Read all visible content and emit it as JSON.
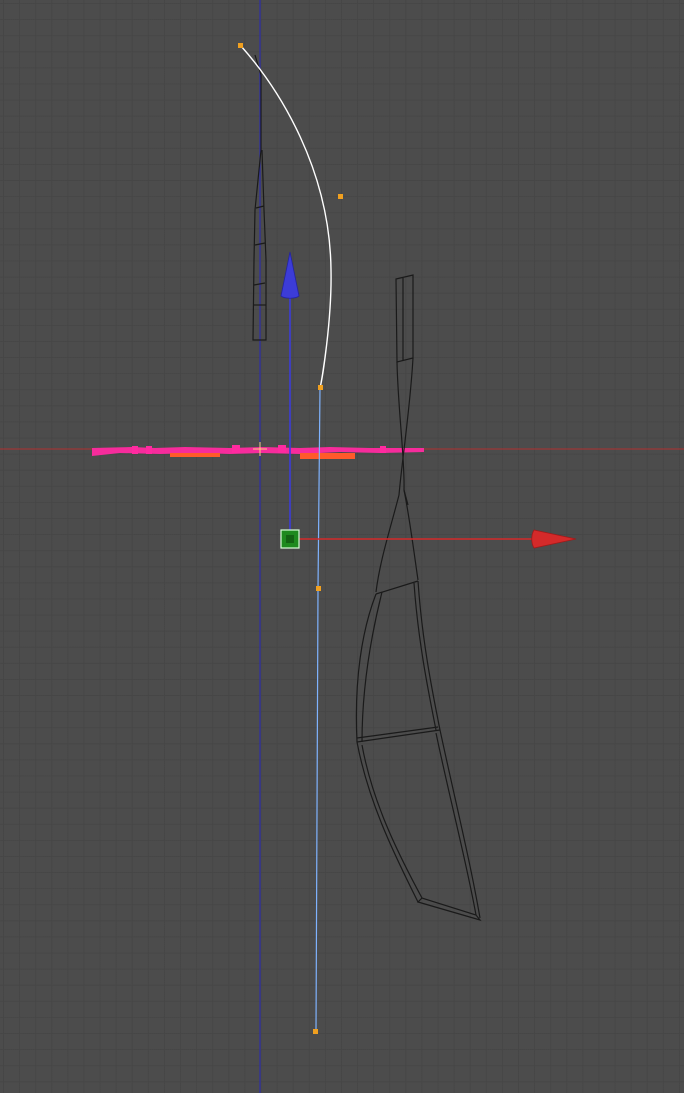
{
  "viewport": {
    "background": "#4c4c4c",
    "grid_color": "#464646"
  },
  "colors": {
    "z_axis_line": "#2f2fa8",
    "x_axis_line": "#b03030",
    "curve_selected": "#ffffff",
    "curve_unselected": "#7fb3ff",
    "handle_point": "#f0a020",
    "wireframe": "#1a1a1a",
    "gizmo_x": "#d42a2a",
    "gizmo_z": "#3c3cd8",
    "gizmo_center": "#1e8a1e",
    "weight_paint": "#ff2aa0",
    "weight_paint_secondary": "#ff5a2a"
  },
  "icons": {
    "gizmo_x_arrow": "arrow-right-icon",
    "gizmo_z_arrow": "arrow-up-icon",
    "gizmo_center": "center-handle-icon",
    "cursor": "3d-cursor-icon"
  }
}
